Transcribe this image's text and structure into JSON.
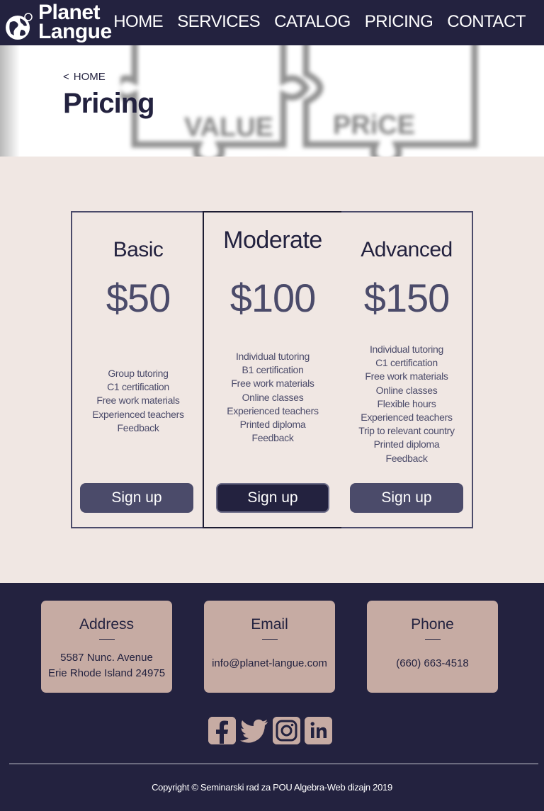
{
  "brand": {
    "line1": "Planet",
    "line2": "Langue"
  },
  "nav": {
    "items": [
      "HOME",
      "SERVICES",
      "CATALOG",
      "PRICING",
      "CONTACT"
    ]
  },
  "hero": {
    "breadcrumb_arrow": "<",
    "breadcrumb_link": "HOME",
    "title": "Pricing",
    "puzzle_words": [
      "VALUE",
      "PRiCE"
    ]
  },
  "plans": [
    {
      "name": "Basic",
      "price": "$50",
      "features": [
        "Group tutoring",
        "C1 certification",
        "Free work materials",
        "Experienced teachers",
        "Feedback"
      ],
      "button": "Sign up"
    },
    {
      "name": "Moderate",
      "price": "$100",
      "features": [
        "Individual tutoring",
        "B1 certification",
        "Free work materials",
        "Online classes",
        "Experienced teachers",
        "Printed diploma",
        "Feedback"
      ],
      "button": "Sign up"
    },
    {
      "name": "Advanced",
      "price": "$150",
      "features": [
        "Individual tutoring",
        "C1 certification",
        "Free work materials",
        "Online classes",
        "Flexible hours",
        "Experienced teachers",
        "Trip to relevant country",
        "Printed diploma",
        "Feedback"
      ],
      "button": "Sign up"
    }
  ],
  "contact": {
    "address": {
      "title": "Address",
      "line1": "5587 Nunc. Avenue",
      "line2": "Erie Rhode Island 24975"
    },
    "email": {
      "title": "Email",
      "value": "info@planet-langue.com"
    },
    "phone": {
      "title": "Phone",
      "value": "(660) 663-4518"
    }
  },
  "socials": [
    "facebook-icon",
    "twitter-icon",
    "instagram-icon",
    "linkedin-icon"
  ],
  "copyright": "Copyright © Seminarski rad za POU Algebra-Web dizajn 2019",
  "colors": {
    "navy": "#23223f",
    "slate": "#4b4b6a",
    "cream": "#f0e7e3",
    "rose": "#c6aba3"
  }
}
